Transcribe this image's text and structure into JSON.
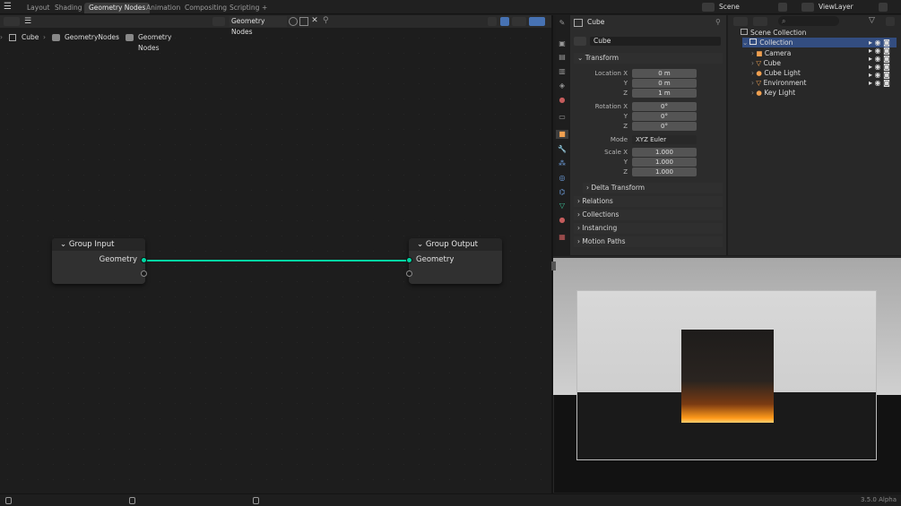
{
  "topbar": {
    "tabs": [
      "Layout",
      "Shading",
      "Geometry Nodes",
      "Animation",
      "Compositing",
      "Scripting",
      "+"
    ],
    "active_tab": "Geometry Nodes",
    "scene": "Scene",
    "view_layer": "ViewLayer"
  },
  "node_editor": {
    "tree_name": "Geometry Nodes",
    "breadcrumb": [
      "Cube",
      "GeometryNodes",
      "Geometry Nodes"
    ],
    "group_input": {
      "title": "Group Input",
      "socket": "Geometry"
    },
    "group_output": {
      "title": "Group Output",
      "socket": "Geometry"
    },
    "link_color": "#00d6a3"
  },
  "properties": {
    "object_name": "Cube",
    "object_field": "Cube",
    "transform_label": "Transform",
    "location": {
      "label": "Location X",
      "x": "0 m",
      "y": "0 m",
      "z": "1 m"
    },
    "rotation": {
      "label": "Rotation X",
      "x": "0°",
      "y": "0°",
      "z": "0°"
    },
    "mode": {
      "label": "Mode",
      "value": "XYZ Euler"
    },
    "scale": {
      "label": "Scale X",
      "x": "1.000",
      "y": "1.000",
      "z": "1.000"
    },
    "axis_y": "Y",
    "axis_z": "Z",
    "subpanels": [
      "Delta Transform",
      "Relations",
      "Collections",
      "Instancing",
      "Motion Paths"
    ]
  },
  "outliner": {
    "scene_collection": "Scene Collection",
    "collection": "Collection",
    "items": [
      "Camera",
      "Cube",
      "Cube Light",
      "Environment",
      "Key Light"
    ]
  },
  "statusbar": {
    "version": "3.5.0 Alpha"
  }
}
